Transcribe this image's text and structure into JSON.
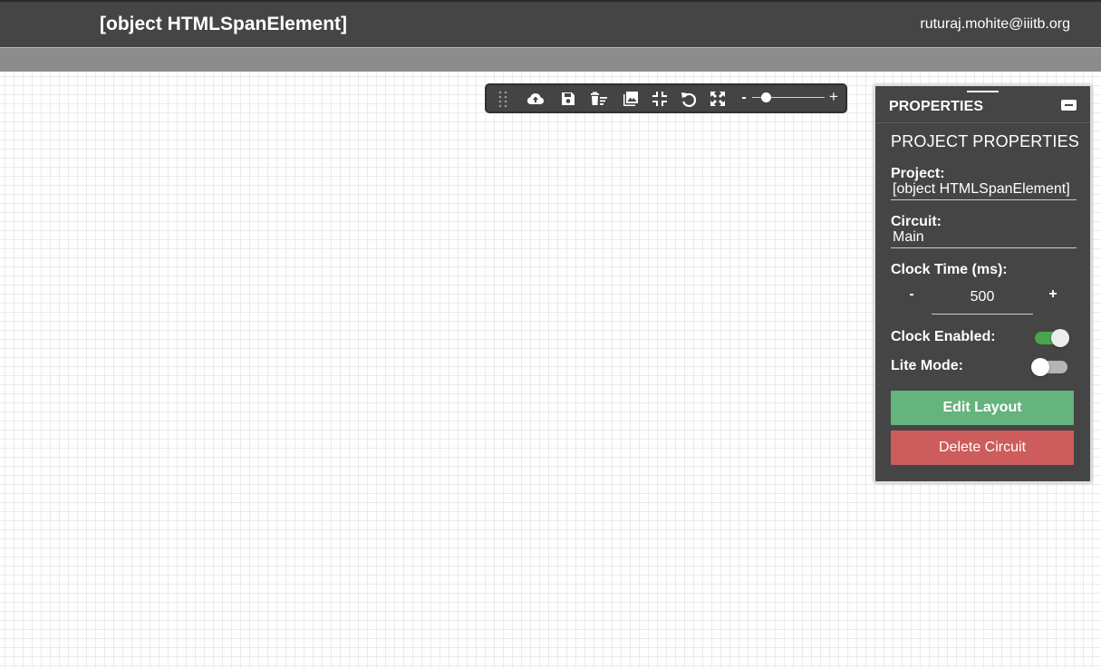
{
  "navbar": {
    "project_title": "[object HTMLSpanElement]",
    "user_email": "ruturaj.mohite@iiitb.org"
  },
  "toolbar": {
    "icons": [
      "drag-handle-icon",
      "cloud-upload-icon",
      "save-icon",
      "delete-all-icon",
      "download-image-icon",
      "fit-to-screen-icon",
      "undo-icon",
      "fullscreen-icon"
    ],
    "zoom_out_label": "-",
    "zoom_in_label": "+",
    "zoom_level": 0.15
  },
  "properties_panel": {
    "title": "PROPERTIES",
    "section_title": "PROJECT PROPERTIES",
    "project_label": "Project:",
    "project_value": "[object HTMLSpanElement]",
    "circuit_label": "Circuit:",
    "circuit_value": "Main",
    "clock_time_label": "Clock Time (ms):",
    "clock_minus": "-",
    "clock_plus": "+",
    "clock_time_value": "500",
    "clock_enabled_label": "Clock Enabled:",
    "clock_enabled": true,
    "lite_mode_label": "Lite Mode:",
    "lite_mode": false,
    "edit_layout_label": "Edit Layout",
    "delete_circuit_label": "Delete Circuit"
  },
  "colors": {
    "navbar_bg": "#454545",
    "tabbar_bg": "#8c8c8c",
    "panel_bg": "#454545",
    "edit_button": "#65b37d",
    "delete_button": "#cd5c5c",
    "toggle_on": "#4caf50"
  }
}
